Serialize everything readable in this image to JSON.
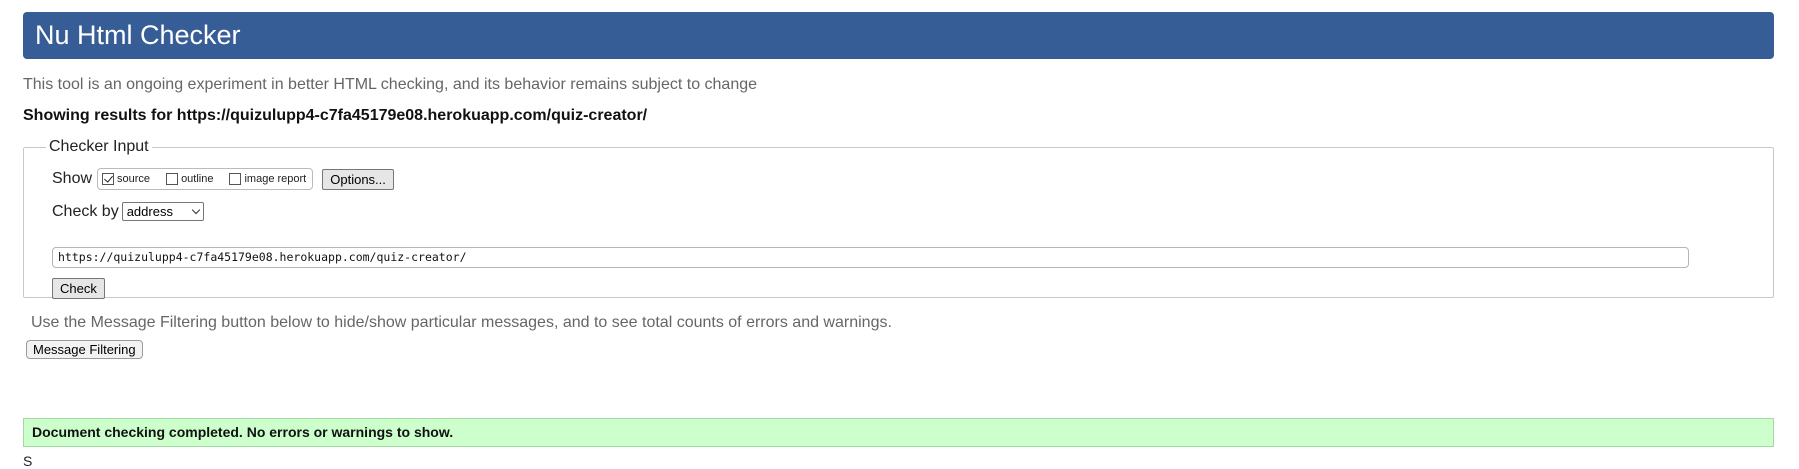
{
  "header": {
    "title": "Nu Html Checker"
  },
  "intro": "This tool is an ongoing experiment in better HTML checking, and its behavior remains subject to change",
  "results_for": "Showing results for https://quizulupp4-c7fa45179e08.herokuapp.com/quiz-creator/",
  "checker_input": {
    "legend": "Checker Input",
    "show_label": "Show",
    "show_options": [
      {
        "label": "source",
        "checked": true
      },
      {
        "label": "outline",
        "checked": false
      },
      {
        "label": "image report",
        "checked": false
      }
    ],
    "options_button": "Options...",
    "check_by_label": "Check by",
    "check_by_selected": "address",
    "url_value": "https://quizulupp4-c7fa45179e08.herokuapp.com/quiz-creator/",
    "check_button": "Check"
  },
  "filtering": {
    "note": "Use the Message Filtering button below to hide/show particular messages, and to see total counts of errors and warnings.",
    "button": "Message Filtering"
  },
  "result_message": "Document checking completed. No errors or warnings to show.",
  "trailing_text": "S",
  "colors": {
    "header_bg": "#365d95",
    "success_bg": "#ccffcc"
  }
}
